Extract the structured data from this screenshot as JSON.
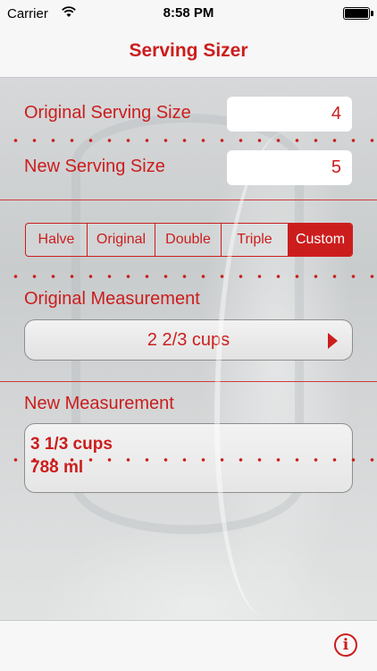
{
  "status_bar": {
    "carrier": "Carrier",
    "time": "8:58 PM",
    "wifi_icon": "wifi-icon",
    "battery_icon": "battery-icon"
  },
  "nav": {
    "title": "Serving Sizer"
  },
  "serving": {
    "original_label": "Original Serving Size",
    "original_value": "4",
    "new_label": "New Serving Size",
    "new_value": "5"
  },
  "presets": {
    "selected": "Custom",
    "options": [
      "Halve",
      "Original",
      "Double",
      "Triple",
      "Custom"
    ]
  },
  "original_measurement": {
    "label": "Original Measurement",
    "value": "2 2/3 cups",
    "arrow_icon": "disclosure-arrow-icon"
  },
  "new_measurement": {
    "label": "New Measurement",
    "line1": "3 1/3 cups",
    "line2": "788 ml"
  },
  "toolbar": {
    "info_icon": "info-icon",
    "info_glyph": "i"
  },
  "colors": {
    "accent": "#cc1d1d",
    "bar": "#f7f7f7"
  }
}
